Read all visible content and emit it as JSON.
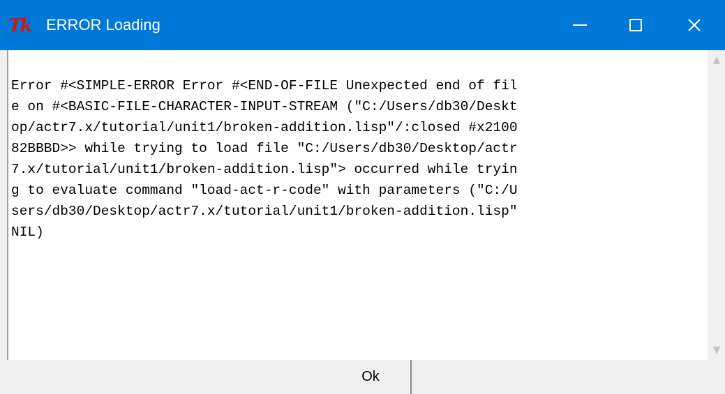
{
  "window": {
    "title": "ERROR Loading",
    "icon": "Tk",
    "icon_color": "#d81313",
    "titlebar_color": "#0078d7",
    "controls": {
      "minimize": "minimize-icon",
      "maximize": "maximize-icon",
      "close": "✕"
    }
  },
  "message": {
    "lines": [
      "Error #<SIMPLE-ERROR Error #<END-OF-FILE Unexpected end of fil",
      "e on #<BASIC-FILE-CHARACTER-INPUT-STREAM (\"C:/Users/db30/Deskt",
      "op/actr7.x/tutorial/unit1/broken-addition.lisp\"/:closed #x2100",
      "82BBBD>> while trying to load file \"C:/Users/db30/Desktop/actr",
      "7.x/tutorial/unit1/broken-addition.lisp\"> occurred while tryin",
      "g to evaluate command \"load-act-r-code\" with parameters (\"C:/U",
      "sers/db30/Desktop/actr7.x/tutorial/unit1/broken-addition.lisp\"",
      "NIL)"
    ]
  },
  "scrollbar": {
    "up": "▲",
    "down": "▼"
  },
  "buttons": {
    "ok": "Ok"
  }
}
